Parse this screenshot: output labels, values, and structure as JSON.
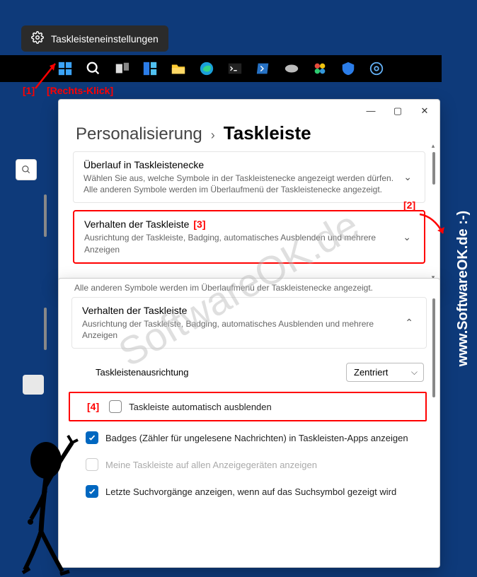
{
  "watermark": "SoftwareOK.de",
  "side_text": "www.SoftwareOK.de :-)",
  "context_menu": {
    "label": "Taskleisteneinstellungen"
  },
  "taskbar_icons": [
    "start",
    "search",
    "tasks",
    "widgets",
    "explorer",
    "edge",
    "terminal",
    "powershell",
    "tool",
    "app",
    "defender",
    "settings"
  ],
  "annotations": {
    "a1": "[1]",
    "a1_text": "[Rechts-Klick]",
    "a2": "[2]",
    "a3": "[3]",
    "a4": "[4]"
  },
  "win1": {
    "breadcrumb": {
      "parent": "Personalisierung",
      "current": "Taskleiste"
    },
    "panels": [
      {
        "title": "Überlauf in Taskleistenecke",
        "desc": "Wählen Sie aus, welche Symbole in der Taskleistenecke angezeigt werden dürfen. Alle anderen Symbole werden im Überlaufmenü der Taskleistenecke angezeigt."
      },
      {
        "title": "Verhalten der Taskleiste",
        "desc": "Ausrichtung der Taskleiste, Badging, automatisches Ausblenden und mehrere Anzeigen"
      }
    ]
  },
  "win2": {
    "truncated": "Alle anderen Symbole werden im Überlaufmenü der Taskleistenecke angezeigt.",
    "panel": {
      "title": "Verhalten der Taskleiste",
      "desc": "Ausrichtung der Taskleiste, Badging, automatisches Ausblenden und mehrere Anzeigen"
    },
    "alignment": {
      "label": "Taskleistenausrichtung",
      "value": "Zentriert"
    },
    "options": [
      {
        "label": "Taskleiste automatisch ausblenden",
        "checked": false,
        "highlight": true
      },
      {
        "label": "Badges (Zähler für ungelesene Nachrichten) in Taskleisten-Apps anzeigen",
        "checked": true
      },
      {
        "label": "Meine Taskleiste auf allen Anzeigegeräten anzeigen",
        "checked": false,
        "disabled": true
      },
      {
        "label": "Letzte Suchvorgänge anzeigen, wenn auf das Suchsymbol gezeigt wird",
        "checked": true
      }
    ]
  }
}
